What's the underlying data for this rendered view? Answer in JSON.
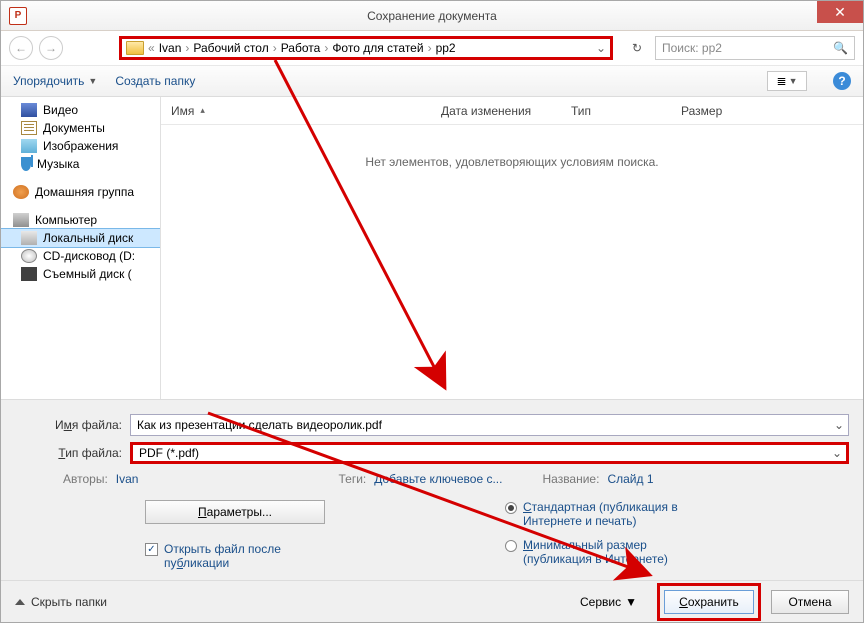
{
  "titlebar": {
    "title": "Сохранение документа",
    "app_icon_letter": "P"
  },
  "breadcrumb": {
    "prefix": "«",
    "items": [
      "Ivan",
      "Рабочий стол",
      "Работа",
      "Фото для статей",
      "pp2"
    ]
  },
  "search": {
    "placeholder": "Поиск: pp2"
  },
  "toolbar": {
    "organize": "Упорядочить",
    "newfolder": "Создать папку"
  },
  "sidebar": {
    "libs": [
      {
        "label": "Видео",
        "icon": "ic-video"
      },
      {
        "label": "Документы",
        "icon": "ic-docs"
      },
      {
        "label": "Изображения",
        "icon": "ic-img"
      },
      {
        "label": "Музыка",
        "icon": "ic-music"
      }
    ],
    "homegroup": "Домашняя группа",
    "computer": "Компьютер",
    "drives": [
      {
        "label": "Локальный диск",
        "icon": "ic-disk",
        "selected": true
      },
      {
        "label": "CD-дисковод (D:",
        "icon": "ic-cd"
      },
      {
        "label": "Съемный диск (",
        "icon": "ic-usb"
      }
    ]
  },
  "columns": {
    "name": "Имя",
    "date": "Дата изменения",
    "type": "Тип",
    "size": "Размер"
  },
  "empty_msg": "Нет элементов, удовлетворяющих условиям поиска.",
  "filename": {
    "label_pre": "И",
    "label_u": "м",
    "label_post": "я файла:",
    "value": "Как из презентации сделать видеоролик.pdf"
  },
  "filetype": {
    "label_pre": "",
    "label_u": "Т",
    "label_post": "ип файла:",
    "value": "PDF (*.pdf)"
  },
  "meta": {
    "authors_lbl": "Авторы:",
    "authors_val": "Ivan",
    "tags_lbl": "Теги:",
    "tags_val": "Добавьте ключевое с...",
    "title_lbl": "Название:",
    "title_val": "Слайд 1"
  },
  "options_btn": "Параметры...",
  "open_after": "Открыть файл после публикации",
  "radios": {
    "standard": "Стандартная (публикация в Интернете и печать)",
    "minimal": "Минимальный размер (публикация в Интернете)"
  },
  "footer": {
    "hide": "Скрыть папки",
    "service": "Сервис",
    "save": "Сохранить",
    "cancel": "Отмена"
  }
}
